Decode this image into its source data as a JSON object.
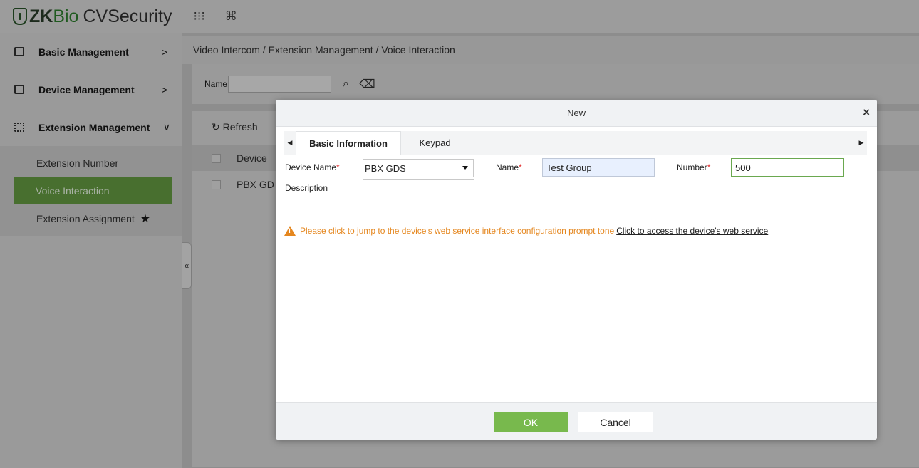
{
  "topbar": {
    "logo_zk": "ZK",
    "logo_bio": "Bio",
    "logo_cvs": "CVSecurity",
    "apps_icon": "grid-dots-icon",
    "cmd_icon": "command-icon"
  },
  "sidebar": {
    "groups": [
      {
        "label": "Basic Management",
        "chevron": ">"
      },
      {
        "label": "Device Management",
        "chevron": ">"
      },
      {
        "label": "Extension Management",
        "chevron": "∨"
      }
    ],
    "items": [
      {
        "label": "Extension Number"
      },
      {
        "label": "Voice Interaction"
      },
      {
        "label": "Extension Assignment",
        "star": "★"
      }
    ]
  },
  "main": {
    "breadcrumb": "Video Intercom / Extension Management / Voice Interaction",
    "search_label": "Name",
    "refresh": "Refresh",
    "col_device": "Device",
    "row_device": "PBX GD",
    "collapse": "«"
  },
  "modal": {
    "title": "New",
    "close": "×",
    "tabs": [
      "Basic Information",
      "Keypad"
    ],
    "device_name_label": "Device Name",
    "device_name_value": "PBX GDS",
    "name_label": "Name",
    "name_value": "Test Group",
    "number_label": "Number",
    "number_value": "500",
    "description_label": "Description",
    "required_mark": "*",
    "warning_text": "Please click to jump to the device's web service interface configuration prompt tone",
    "warning_link": "Click to access the device's web service",
    "ok_label": "OK",
    "cancel_label": "Cancel"
  },
  "colors": {
    "accent_green": "#78b94d",
    "warning_orange": "#e5871f"
  }
}
